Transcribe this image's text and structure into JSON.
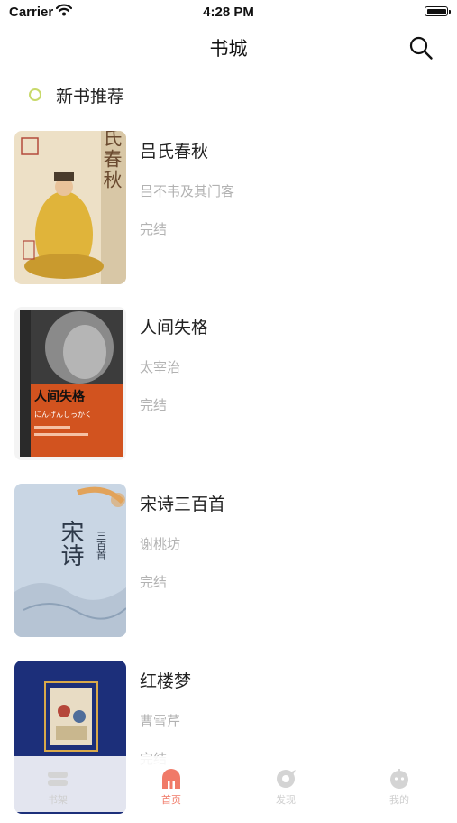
{
  "status_bar": {
    "carrier": "Carrier",
    "time": "4:28 PM"
  },
  "navbar": {
    "title": "书城",
    "search_icon": "search-icon"
  },
  "section": {
    "title": "新书推荐",
    "accent": "#c8d96a"
  },
  "books": [
    {
      "title": "吕氏春秋",
      "author": "吕不韦及其门客",
      "status": "完结",
      "cover_text": "吕氏春秋"
    },
    {
      "title": "人间失格",
      "author": "太宰治",
      "status": "完结",
      "cover_text": "人间失格",
      "cover_subtext": "にんげんしっかく"
    },
    {
      "title": "宋诗三百首",
      "author": "谢桃坊",
      "status": "完结",
      "cover_text": "宋诗",
      "cover_subtext": "三百首"
    },
    {
      "title": "红楼梦",
      "author": "曹雪芹",
      "status": "完结"
    }
  ],
  "tabbar": {
    "active_color": "#f07a68",
    "tabs": [
      {
        "label": "书架",
        "icon": "bookshelf-icon"
      },
      {
        "label": "首页",
        "icon": "home-icon",
        "active": true
      },
      {
        "label": "发现",
        "icon": "discover-icon"
      },
      {
        "label": "我的",
        "icon": "profile-icon"
      }
    ]
  }
}
